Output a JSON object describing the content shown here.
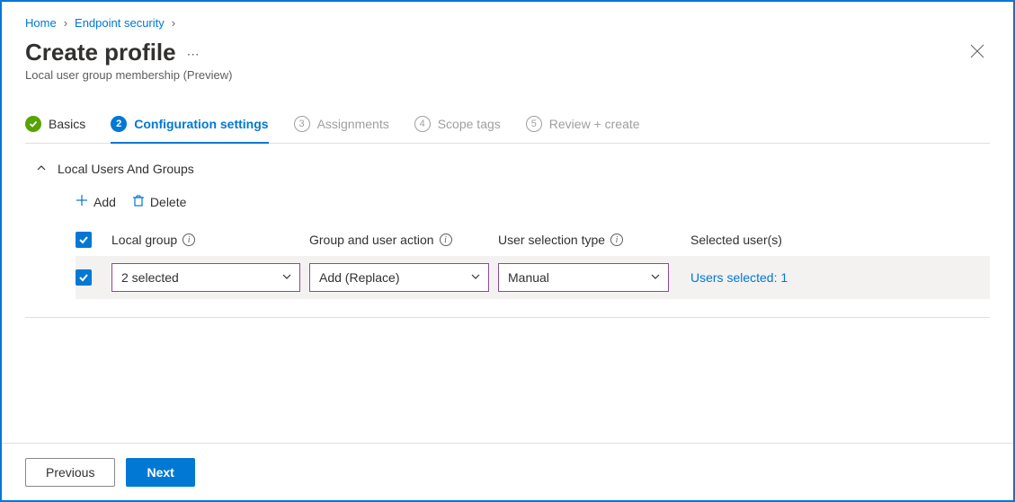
{
  "breadcrumb": {
    "home": "Home",
    "endpoint": "Endpoint security"
  },
  "header": {
    "title": "Create profile",
    "subtitle": "Local user group membership (Preview)"
  },
  "wizard": {
    "step1": {
      "label": "Basics"
    },
    "step2": {
      "num": "2",
      "label": "Configuration settings"
    },
    "step3": {
      "num": "3",
      "label": "Assignments"
    },
    "step4": {
      "num": "4",
      "label": "Scope tags"
    },
    "step5": {
      "num": "5",
      "label": "Review + create"
    }
  },
  "section": {
    "title": "Local Users And Groups"
  },
  "toolbar": {
    "add": "Add",
    "delete": "Delete"
  },
  "columns": {
    "local_group": "Local group",
    "group_user_action": "Group and user action",
    "user_selection_type": "User selection type",
    "selected_users": "Selected user(s)"
  },
  "row": {
    "local_group": "2 selected",
    "action": "Add (Replace)",
    "selection": "Manual",
    "selected": "Users selected: 1"
  },
  "footer": {
    "previous": "Previous",
    "next": "Next"
  }
}
